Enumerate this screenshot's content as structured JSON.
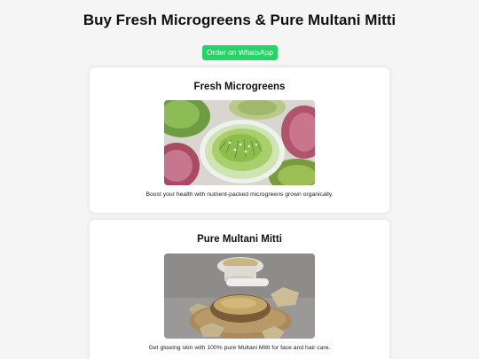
{
  "page": {
    "title": "Buy Fresh Microgreens & Pure Multani Mitti",
    "cta_label": "Order on WhatsApp",
    "cta_color": "#25d366"
  },
  "products": [
    {
      "title": "Fresh Microgreens",
      "description": "Boost your health with nutrient-packed microgreens grown organically.",
      "image": "microgreens-photo"
    },
    {
      "title": "Pure Multani Mitti",
      "description": "Get glowing skin with 100% pure Multani Mitti for face and hair care.",
      "image": "multani-mitti-photo"
    }
  ]
}
